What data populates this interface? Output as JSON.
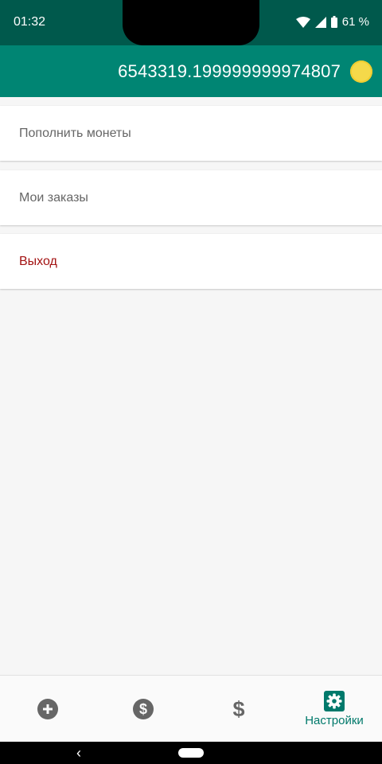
{
  "status_bar": {
    "time": "01:32",
    "battery": "61 %"
  },
  "app_bar": {
    "balance": "6543319.199999999974807",
    "coin_icon": "coin-icon"
  },
  "menu": {
    "items": [
      {
        "label": "Пополнить монеты"
      },
      {
        "label": "Мои заказы"
      },
      {
        "label": "Выход"
      }
    ]
  },
  "bottom_nav": {
    "items": [
      {
        "icon": "add-circle-icon"
      },
      {
        "icon": "dollar-circle-icon"
      },
      {
        "icon": "dollar-icon"
      },
      {
        "icon": "settings-icon",
        "label": "Настройки",
        "active": true
      }
    ]
  },
  "colors": {
    "status_bar": "#00594c",
    "app_bar": "#008573",
    "accent": "#00796b",
    "exit_text": "#a31212",
    "coin": "#f5d94a"
  }
}
